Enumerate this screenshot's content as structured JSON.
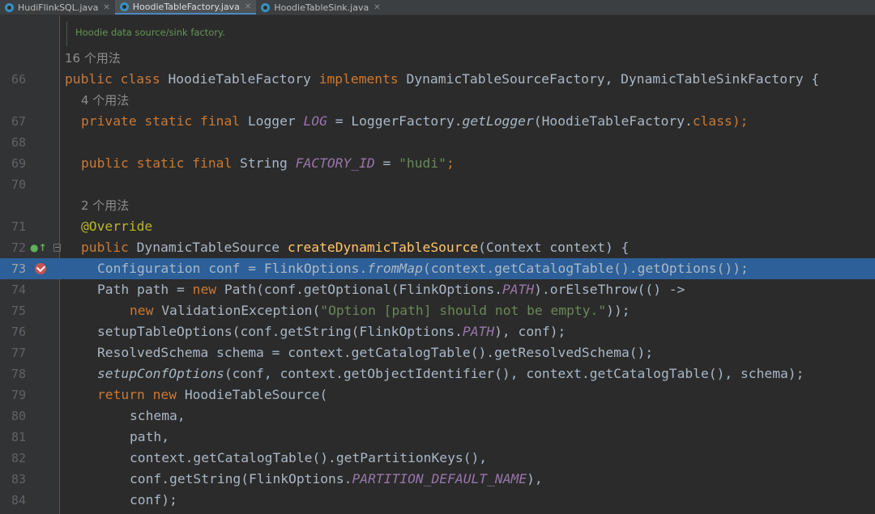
{
  "tabs": [
    {
      "label": "HudiFlinkSQL.java",
      "active": false,
      "icon": "scala-object-icon"
    },
    {
      "label": "HoodieTableFactory.java",
      "active": true,
      "icon": "java-class-icon"
    },
    {
      "label": "HoodieTableSink.java",
      "active": false,
      "icon": "java-class-icon"
    }
  ],
  "doc_comment": "Hoodie data source/sink factory.",
  "usage_hints": {
    "class": "16 个用法",
    "logger": "4 个用法",
    "method": "2 个用法"
  },
  "line_numbers": [
    "66",
    "67",
    "68",
    "69",
    "70",
    "71",
    "72",
    "73",
    "74",
    "75",
    "76",
    "77",
    "78",
    "79",
    "80",
    "81",
    "82",
    "83",
    "84"
  ],
  "current_line": "73",
  "colors": {
    "background": "#2b2b2b",
    "gutter": "#313335",
    "highlight": "#2d6099",
    "keyword": "#cc7832",
    "string": "#6a8759",
    "function": "#ffc66d",
    "annotation": "#bbb529",
    "static_field": "#9876aa",
    "doc": "#629755"
  },
  "code": {
    "l66": [
      "public class ",
      "HoodieTableFactory ",
      "implements ",
      "DynamicTableSourceFactory, DynamicTableSinkFactory {"
    ],
    "l67": [
      "private static final ",
      "Logger ",
      "LOG",
      " = LoggerFactory.",
      "getLogger",
      "(HoodieTableFactory.",
      "class",
      ");"
    ],
    "l69": [
      "public static final ",
      "String ",
      "FACTORY_ID",
      " = ",
      "\"hudi\"",
      ";"
    ],
    "l71": [
      "@Override"
    ],
    "l72": [
      "public ",
      "DynamicTableSource ",
      "createDynamicTableSource",
      "(Context context) {"
    ],
    "l73": [
      "Configuration conf = FlinkOptions.",
      "fromMap",
      "(context.getCatalogTable().getOptions());"
    ],
    "l74": [
      "Path path = ",
      "new ",
      "Path(conf.getOptional(FlinkOptions.",
      "PATH",
      ").orElseThrow(() ->"
    ],
    "l75": [
      "new ",
      "ValidationException(",
      "\"Option [path] should not be empty.\"",
      "));"
    ],
    "l76": [
      "setupTableOptions(conf.getString(FlinkOptions.",
      "PATH",
      "), conf);"
    ],
    "l77": [
      "ResolvedSchema schema = context.getCatalogTable().getResolvedSchema();"
    ],
    "l78": [
      "setupConfOptions",
      "(conf, context.getObjectIdentifier(), context.getCatalogTable(), schema);"
    ],
    "l79": [
      "return new ",
      "HoodieTableSource("
    ],
    "l80": [
      "schema,"
    ],
    "l81": [
      "path,"
    ],
    "l82": [
      "context.getCatalogTable().getPartitionKeys(),"
    ],
    "l83": [
      "conf.getString(FlinkOptions.",
      "PARTITION_DEFAULT_NAME",
      "),"
    ],
    "l84": [
      "conf);"
    ]
  },
  "gutter_icons": {
    "override": "override-marker-icon",
    "breakpoint": "breakpoint-icon",
    "fold": "fold-icon"
  }
}
